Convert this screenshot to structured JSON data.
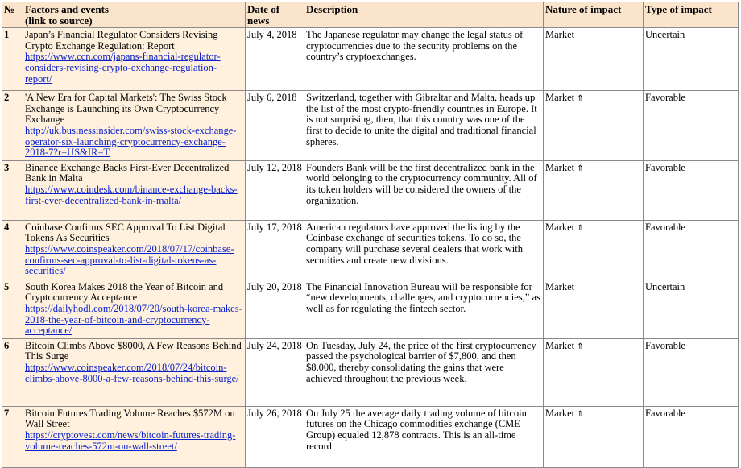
{
  "headers": {
    "num": "№",
    "factors_line1": "Factors and events",
    "factors_line2": "(link to source)",
    "date": "Date of news",
    "description": "Description",
    "nature": "Nature of impact",
    "type": "Type of impact"
  },
  "rows": [
    {
      "num": "1",
      "title": "Japan’s Financial Regulator Considers Revising Crypto Exchange Regulation: Report",
      "link": "https://www.ccn.com/japans-financial-regulator-considers-revising-crypto-exchange-regulation-report/",
      "date": "July 4, 2018",
      "description": "The Japanese regulator may change the legal status of cryptocurrencies due to the security problems on the country’s cryptoexchanges.",
      "nature": "Market",
      "nature_arrow": "",
      "type": "Uncertain"
    },
    {
      "num": "2",
      "title": "'A New Era for Capital Markets': The Swiss Stock Exchange is Launching its Own Cryptocurrency Exchange",
      "link": "http://uk.businessinsider.com/swiss-stock-exchange-operator-six-launching-cryptocurrency-exchange-2018-7?r=US&IR=T",
      "date": "July 6, 2018",
      "description": "Switzerland, together with Gibraltar and Malta, heads up the list of the most crypto-friendly countries in Europe. It is not surprising, then, that this country was one of the first to decide to unite the digital and traditional financial spheres.",
      "nature": "Market",
      "nature_arrow": "⇑",
      "type": "Favorable"
    },
    {
      "num": "3",
      "title": "Binance Exchange Backs First-Ever Decentralized Bank in Malta",
      "link": "https://www.coindesk.com/binance-exchange-backs-first-ever-decentralized-bank-in-malta/",
      "date": "July 12, 2018",
      "description": "Founders Bank will be the first decentralized bank in the world belonging to the cryptocurrency community. All of its token holders will be considered the owners of the organization.",
      "nature": "Market",
      "nature_arrow": "⇑",
      "type": "Favorable"
    },
    {
      "num": "4",
      "title": "Coinbase Confirms SEC Approval To List Digital Tokens As Securities",
      "link": "https://www.coinspeaker.com/2018/07/17/coinbase-confirms-sec-approval-to-list-digital-tokens-as-securities/",
      "date": "July 17, 2018",
      "description": "American regulators have approved the listing by the Coinbase exchange of securities tokens. To do so, the company will purchase several dealers that work with securities and create new divisions.",
      "nature": "Market",
      "nature_arrow": "⇑",
      "type": "Favorable"
    },
    {
      "num": "5",
      "title": "South Korea Makes 2018 the Year of Bitcoin and Cryptocurrency Acceptance",
      "link": "https://dailyhodl.com/2018/07/20/south-korea-makes-2018-the-year-of-bitcoin-and-cryptocurrency-acceptance/",
      "date": "July 20, 2018",
      "description": "The Financial Innovation Bureau will be responsible for “new developments, challenges, and cryptocurrencies,” as well as for regulating the fintech sector.",
      "nature": "Market",
      "nature_arrow": "",
      "type": "Uncertain"
    },
    {
      "num": "6",
      "title": "Bitcoin Climbs Above $8000, A Few Reasons Behind This Surge",
      "link": "https://www.coinspeaker.com/2018/07/24/bitcoin-climbs-above-8000-a-few-reasons-behind-this-surge/",
      "date": "July 24, 2018",
      "description": "On Tuesday, July 24, the price of the first cryptocurrency passed the psychological barrier of $7,800, and then $8,000, thereby consolidating the gains that were achieved throughout the previous week.",
      "nature": "Market",
      "nature_arrow": "⇑",
      "type": "Favorable"
    },
    {
      "num": "7",
      "title": "Bitcoin Futures Trading Volume Reaches $572M on Wall Street",
      "link": "https://cryptovest.com/news/bitcoin-futures-trading-volume-reaches-572m-on-wall-street/",
      "date": "July 26, 2018",
      "description": "On July 25 the average daily trading volume of bitcoin futures on the Chicago commodities exchange (CME Group) equaled 12,878 contracts. This is an all-time record.",
      "nature": "Market",
      "nature_arrow": "⇑",
      "type": "Favorable"
    }
  ]
}
